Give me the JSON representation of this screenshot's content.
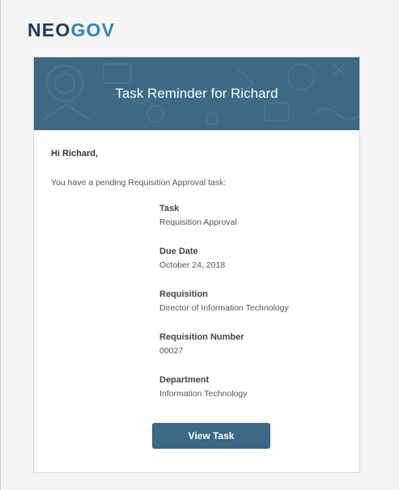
{
  "logo": {
    "neo": "NEO",
    "gov": "GOV"
  },
  "colors": {
    "banner": "#3d6886",
    "button": "#3d6886",
    "logo_dark": "#1f3b57",
    "logo_accent": "#2f86b5"
  },
  "email": {
    "banner_title": "Task Reminder for Richard",
    "greeting": "Hi Richard,",
    "intro": "You have a pending Requisition Approval task:",
    "fields": [
      {
        "label": "Task",
        "value": "Requisition Approval"
      },
      {
        "label": "Due Date",
        "value": "October 24, 2018"
      },
      {
        "label": "Requisition",
        "value": "Director of Information Technology"
      },
      {
        "label": "Requisition Number",
        "value": "00027"
      },
      {
        "label": "Department",
        "value": "Information Technology"
      }
    ],
    "button_label": "View Task"
  }
}
